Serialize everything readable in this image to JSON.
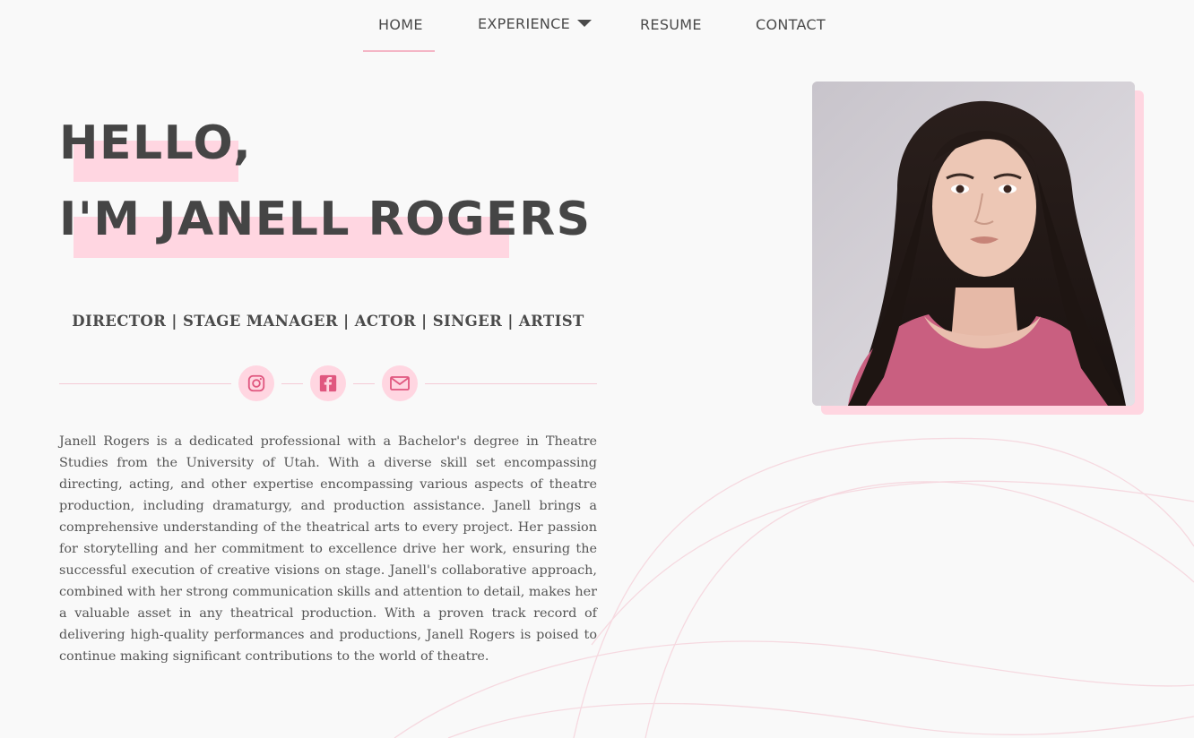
{
  "nav": {
    "home": "HOME",
    "experience": "EXPERIENCE",
    "resume": "RESUME",
    "contact": "CONTACT"
  },
  "hero": {
    "line1": "HELLO,",
    "line2": "I'M JANELL ROGERS",
    "roles": "DIRECTOR | STAGE MANAGER | ACTOR | SINGER | ARTIST",
    "bio": "Janell Rogers is a dedicated professional with a Bachelor's degree in Theatre Studies from the University of Utah. With a diverse skill set encompassing directing, acting, and other expertise encompassing various aspects of theatre production, including dramaturgy, and production assistance. Janell brings a comprehensive understanding of the theatrical arts to every project. Her passion for storytelling and her commitment to excellence drive her work, ensuring the successful execution of creative visions on stage. Janell's collaborative approach, combined with her strong communication skills and attention to detail, makes her a valuable asset in any theatrical production. With a proven track record of delivering high-quality performances and productions, Janell Rogers is poised to continue making significant contributions to the world of theatre."
  },
  "social": {
    "instagram_icon": "instagram-icon",
    "facebook_icon": "facebook-icon",
    "email_icon": "mail-icon"
  },
  "colors": {
    "accent": "#ffd6e1",
    "accent_strong": "#e0577f",
    "text": "#454545",
    "background": "#f9f9f9"
  }
}
